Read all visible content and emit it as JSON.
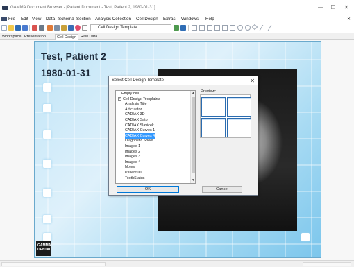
{
  "window": {
    "title": "GAMMA Document Browser - [Patient Document - Test, Patient 2, 1980-01-31]",
    "minimize": "—",
    "maximize": "☐",
    "close": "✕"
  },
  "menu": {
    "items": [
      "File",
      "Edit",
      "View",
      "Data",
      "Schema",
      "Section",
      "Analysis Collection",
      "Cell Design",
      "Extras",
      "Windows",
      "Help"
    ],
    "doc_close": "✕"
  },
  "toolbar": {
    "template_select": "Cell Design Template"
  },
  "tabs": [
    "Workspace",
    "Presentation",
    "Cell Design",
    "Raw Data"
  ],
  "document": {
    "patient_name": "Test, Patient 2",
    "birth_date": "1980-01-31",
    "logo_line1": "GAMMA",
    "logo_line2": "DENTAL"
  },
  "dialog": {
    "title": "Select Cell Design Template",
    "close": "✕",
    "preview_label": "Preview:",
    "ok": "OK",
    "cancel": "Cancel",
    "tree": [
      {
        "label": "Empty cell",
        "indent": 1,
        "expander": ""
      },
      {
        "label": "Cell Design Templates",
        "indent": 0,
        "expander": "−"
      },
      {
        "label": "Analysis Title",
        "indent": 2,
        "expander": ""
      },
      {
        "label": "Articulator",
        "indent": 2,
        "expander": ""
      },
      {
        "label": "CADIAX 3D",
        "indent": 2,
        "expander": ""
      },
      {
        "label": "CADIAX Sato",
        "indent": 2,
        "expander": ""
      },
      {
        "label": "CADIAX Slavicek",
        "indent": 2,
        "expander": ""
      },
      {
        "label": "CADIAX Curves 1",
        "indent": 2,
        "expander": ""
      },
      {
        "label": "CADIAX Curves 4",
        "indent": 2,
        "expander": "",
        "selected": true
      },
      {
        "label": "Diagnostic Sheet",
        "indent": 2,
        "expander": ""
      },
      {
        "label": "Images 1",
        "indent": 2,
        "expander": ""
      },
      {
        "label": "Images 2",
        "indent": 2,
        "expander": ""
      },
      {
        "label": "Images 3",
        "indent": 2,
        "expander": ""
      },
      {
        "label": "Images 4",
        "indent": 2,
        "expander": ""
      },
      {
        "label": "Notes",
        "indent": 2,
        "expander": ""
      },
      {
        "label": "Patient ID",
        "indent": 2,
        "expander": ""
      },
      {
        "label": "ToothStatus",
        "indent": 2,
        "expander": ""
      }
    ]
  },
  "colors": {
    "selection": "#3399ff",
    "canvas_light": "#dff1fb",
    "canvas_dark": "#7cc6ec"
  }
}
